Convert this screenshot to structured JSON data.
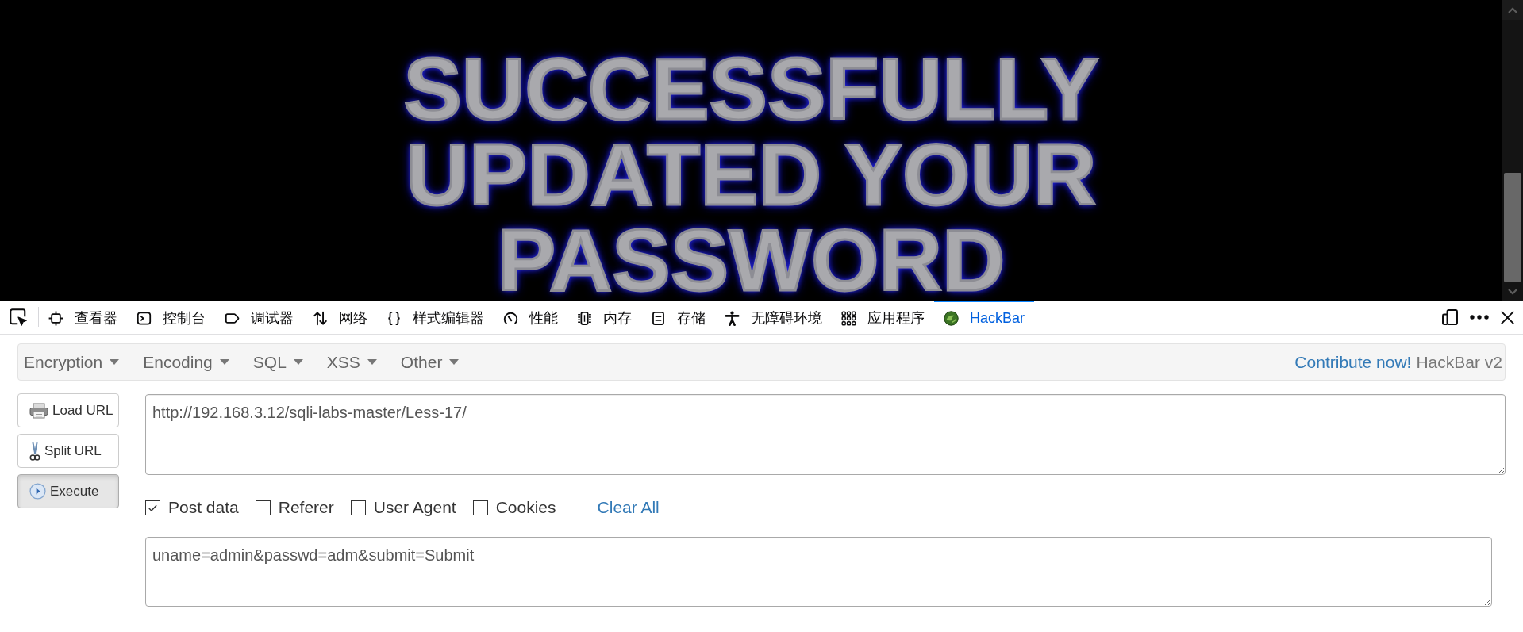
{
  "page": {
    "banner": "SUCCESSFULLY\nUPDATED YOUR\nPASSWORD"
  },
  "devtools": {
    "tabs": [
      {
        "label": "查看器",
        "selected": false
      },
      {
        "label": "控制台",
        "selected": false
      },
      {
        "label": "调试器",
        "selected": false
      },
      {
        "label": "网络",
        "selected": false
      },
      {
        "label": "样式编辑器",
        "selected": false
      },
      {
        "label": "性能",
        "selected": false
      },
      {
        "label": "内存",
        "selected": false
      },
      {
        "label": "存储",
        "selected": false
      },
      {
        "label": "无障碍环境",
        "selected": false
      },
      {
        "label": "应用程序",
        "selected": false
      },
      {
        "label": "HackBar",
        "selected": true
      }
    ]
  },
  "hackbar": {
    "menus": [
      "Encryption",
      "Encoding",
      "SQL",
      "XSS",
      "Other"
    ],
    "contribute_link": "Contribute now!",
    "version": "HackBar v2",
    "buttons": [
      {
        "label": "Load URL",
        "pressed": false
      },
      {
        "label": "Split URL",
        "pressed": false
      },
      {
        "label": "Execute",
        "pressed": true
      }
    ],
    "url": {
      "value": "http://192.168.3.12/sqli-labs-master/Less-17/"
    },
    "options": [
      {
        "label": "Post data",
        "checked": true
      },
      {
        "label": "Referer",
        "checked": false
      },
      {
        "label": "User Agent",
        "checked": false
      },
      {
        "label": "Cookies",
        "checked": false
      }
    ],
    "clear_all": "Clear All",
    "post_data": {
      "value": "uname=admin&passwd=adm&submit=Submit"
    }
  }
}
